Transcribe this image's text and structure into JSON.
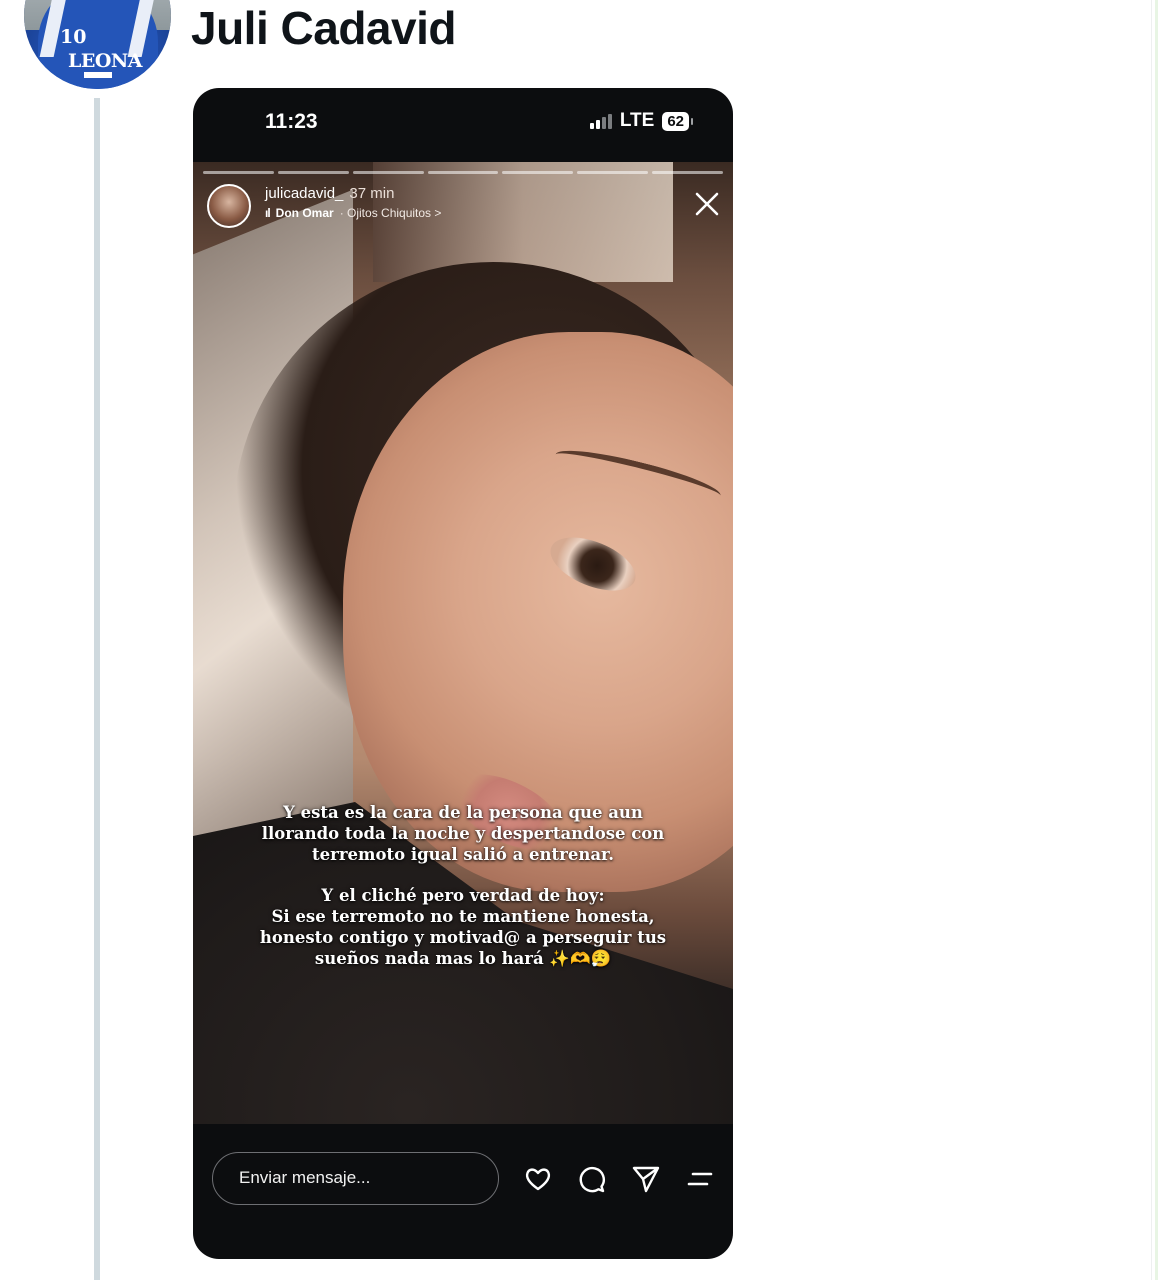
{
  "post": {
    "author_name": "Juli Cadavid",
    "avatar_text": {
      "number": "10",
      "brand": "LEONA"
    }
  },
  "phone": {
    "status_time": "11:23",
    "network": "LTE",
    "battery": "62"
  },
  "story": {
    "username": "julicadavid_",
    "time_ago": "37 min",
    "music_icon": "ıl",
    "music_artist": "Don Omar",
    "music_song": "· Ojitos Chiquitos >",
    "progress_segments": 7,
    "caption_paragraph_1": "Y esta es la cara de la persona que aun\nllorando toda la noche y despertandose con\nterremoto igual salió a entrenar.",
    "caption_paragraph_2": "Y el cliché pero verdad de hoy:\nSi ese terremoto no te mantiene honesta,\nhonesto contigo y motivad@ a perseguir tus\nsueños nada mas lo hará ✨🫶😮‍💨"
  },
  "composer": {
    "placeholder": "Enviar mensaje..."
  },
  "icons": {
    "like": "heart-icon",
    "comment": "comment-icon",
    "share": "send-icon",
    "more": "menu-icon",
    "close": "close-icon"
  }
}
